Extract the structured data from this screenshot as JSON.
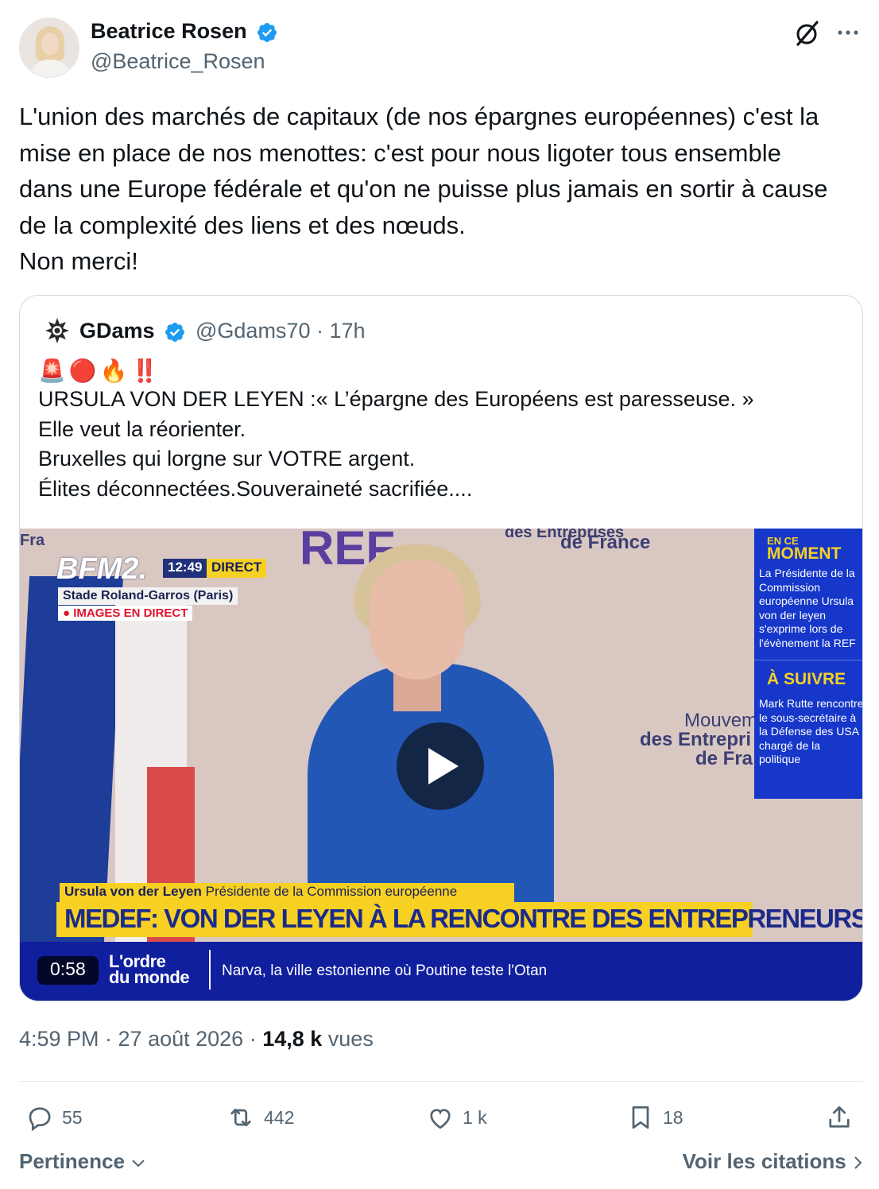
{
  "author": {
    "name": "Beatrice Rosen",
    "handle": "@Beatrice_Rosen",
    "verified_color": "#1d9bf0"
  },
  "tweet": {
    "lines": [
      "L'union des marchés de capitaux (de nos épargnes européennes) c'est la",
      "mise en place de nos menottes: c'est pour nous ligoter tous ensemble",
      "dans une Europe fédérale et qu'on ne puisse plus jamais en sortir à cause",
      "de la complexité des liens et des nœuds.",
      "Non merci!"
    ]
  },
  "quote": {
    "name": "GDams",
    "handle": "@Gdams70 · 17h",
    "emoji": [
      "🚨",
      "🔴",
      "🔥",
      "‼️"
    ],
    "lines": [
      "URSULA VON DER LEYEN :« L’épargne des Européens est paresseuse. »",
      "Elle veut la réorienter.",
      "Bruxelles qui lorgne sur VOTRE argent.",
      "Élites déconnectées.Souveraineté sacrifiée...."
    ],
    "video": {
      "channel": "BFM2.",
      "time": "12:49",
      "live_label": "DIRECT",
      "location": "Stade Roland-Garros (Paris)",
      "live_images": "● IMAGES EN DIRECT",
      "bg_text_top_right": "de France",
      "bg_text_top": "des Entreprises",
      "bg_text_left": "Fra",
      "bg_text_right_1": "Mouvem",
      "bg_text_right_2": "des Entrepri",
      "bg_text_right_3": "de Fra",
      "side_panel": {
        "en_ce": "EN CE",
        "moment": "MOMENT",
        "moment_text": "La Présidente de la Commission européenne Ursula von der leyen s'exprime lors de l'évènement la REF",
        "next_title": "À SUIVRE",
        "next_text": "Mark Rutte rencontre le sous-secrétaire à la Défense des USA chargé de la politique"
      },
      "speaker_name": "Ursula von der Leyen",
      "speaker_title": "Présidente de la Commission européenne",
      "headline": "MEDEF: VON DER LEYEN À LA RENCONTRE DES ENTREPRENEURS",
      "duration": "0:58",
      "program_line1": "L'ordre",
      "program_line2": "du monde",
      "ticker": "Narva, la ville estonienne où Poutine teste l'Otan",
      "play_icon": "play-icon"
    }
  },
  "meta": {
    "time": "4:59 PM · 27 août 2026 · ",
    "views": "14,8 k",
    "views_label": " vues"
  },
  "actions": {
    "replies": "55",
    "reposts": "442",
    "likes": "1 k",
    "bookmarks": "18"
  },
  "footer": {
    "sort_label": "Pertinence",
    "quotes_label": "Voir les citations"
  },
  "icons": {
    "more": "more-icon",
    "grok": "grok-icon",
    "reply": "reply-icon",
    "repost": "repost-icon",
    "like": "heart-icon",
    "bookmark": "bookmark-icon",
    "share": "share-icon"
  }
}
